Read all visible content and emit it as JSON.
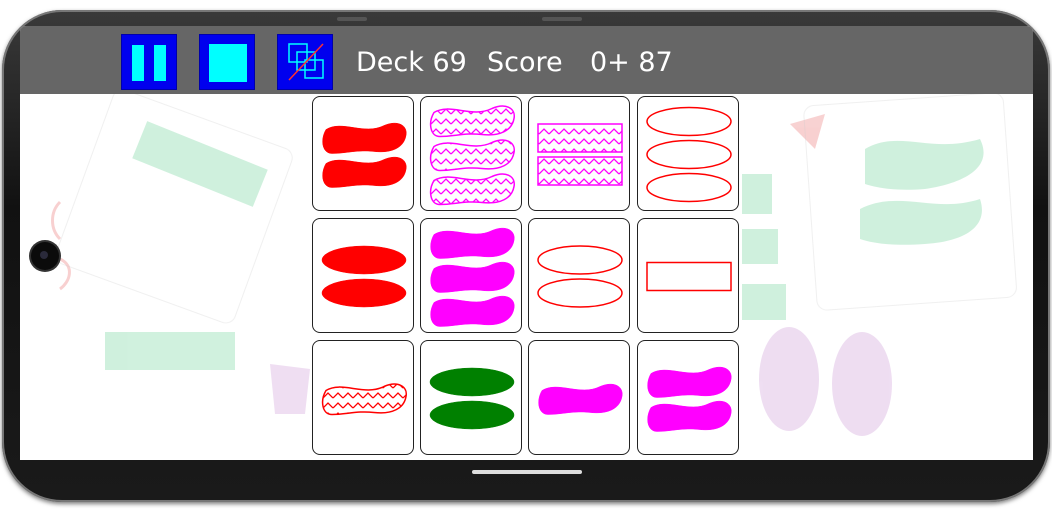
{
  "hud": {
    "deck_label": "Deck 69",
    "score_label": "Score",
    "score_value": "0+ 87"
  },
  "controls": [
    {
      "name": "pause-button",
      "icon": "pause-icon"
    },
    {
      "name": "stop-button",
      "icon": "stop-icon"
    },
    {
      "name": "hint-button",
      "icon": "overlapping-squares-icon"
    }
  ],
  "colors": {
    "top_bar": "#666666",
    "button_bg": "#0000ee",
    "button_icon": "#00ffff",
    "red": "#ff0000",
    "purple": "#ff00ff",
    "green": "#008000"
  },
  "cards": [
    {
      "number": 2,
      "shape": "squiggle",
      "shading": "solid",
      "color": "red"
    },
    {
      "number": 3,
      "shape": "squiggle",
      "shading": "striped",
      "color": "purple"
    },
    {
      "number": 2,
      "shape": "rectangle",
      "shading": "striped",
      "color": "purple"
    },
    {
      "number": 3,
      "shape": "oval",
      "shading": "open",
      "color": "red"
    },
    {
      "number": 2,
      "shape": "oval",
      "shading": "solid",
      "color": "red"
    },
    {
      "number": 3,
      "shape": "squiggle",
      "shading": "solid",
      "color": "purple"
    },
    {
      "number": 2,
      "shape": "oval",
      "shading": "open",
      "color": "red"
    },
    {
      "number": 1,
      "shape": "rectangle",
      "shading": "open",
      "color": "red"
    },
    {
      "number": 1,
      "shape": "squiggle",
      "shading": "striped",
      "color": "red"
    },
    {
      "number": 2,
      "shape": "oval",
      "shading": "solid",
      "color": "green"
    },
    {
      "number": 1,
      "shape": "squiggle",
      "shading": "solid",
      "color": "purple"
    },
    {
      "number": 2,
      "shape": "squiggle",
      "shading": "solid",
      "color": "purple"
    }
  ]
}
